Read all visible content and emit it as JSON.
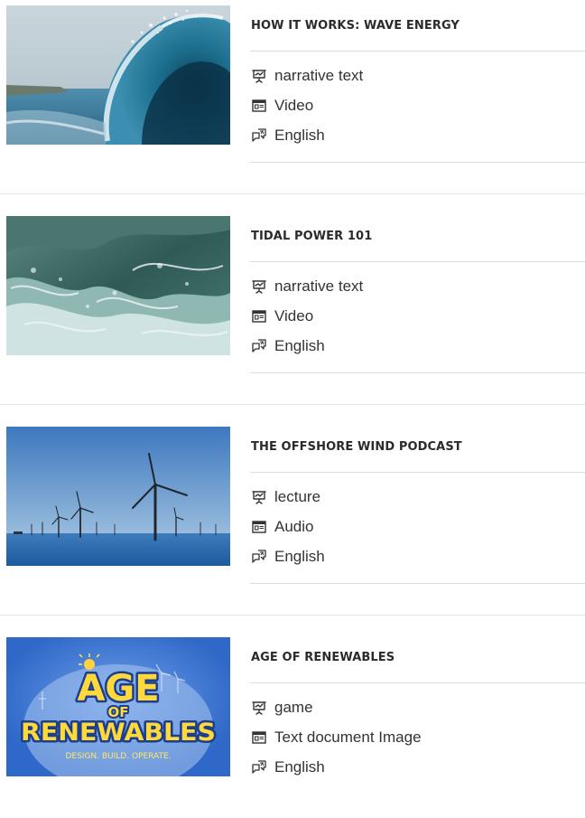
{
  "resources": [
    {
      "title": "HOW IT WORKS: WAVE ENERGY",
      "thumbnail": "wave-curl-photo",
      "type": "narrative text",
      "format": "Video",
      "language": "English"
    },
    {
      "title": "TIDAL POWER 101",
      "thumbnail": "stormy-sea-photo",
      "type": "narrative text",
      "format": "Video",
      "language": "English"
    },
    {
      "title": "THE OFFSHORE WIND PODCAST",
      "thumbnail": "offshore-wind-turbines-photo",
      "type": "lecture",
      "format": "Audio",
      "language": "English"
    },
    {
      "title": "AGE OF RENEWABLES",
      "thumbnail": "age-of-renewables-logo",
      "logo_text": [
        "AGE",
        "OF",
        "RENEWABLES",
        "DESIGN. BUILD. OPERATE."
      ],
      "type": "game",
      "format": "Text document Image",
      "language": "English"
    }
  ],
  "icons": {
    "type": "presentation-icon",
    "format": "document-window-icon",
    "language": "translate-icon"
  },
  "colors": {
    "title": "#2b2b2b",
    "text": "#333333",
    "divider": "#dcdcdc",
    "logo_blue": "#2f68c8"
  }
}
